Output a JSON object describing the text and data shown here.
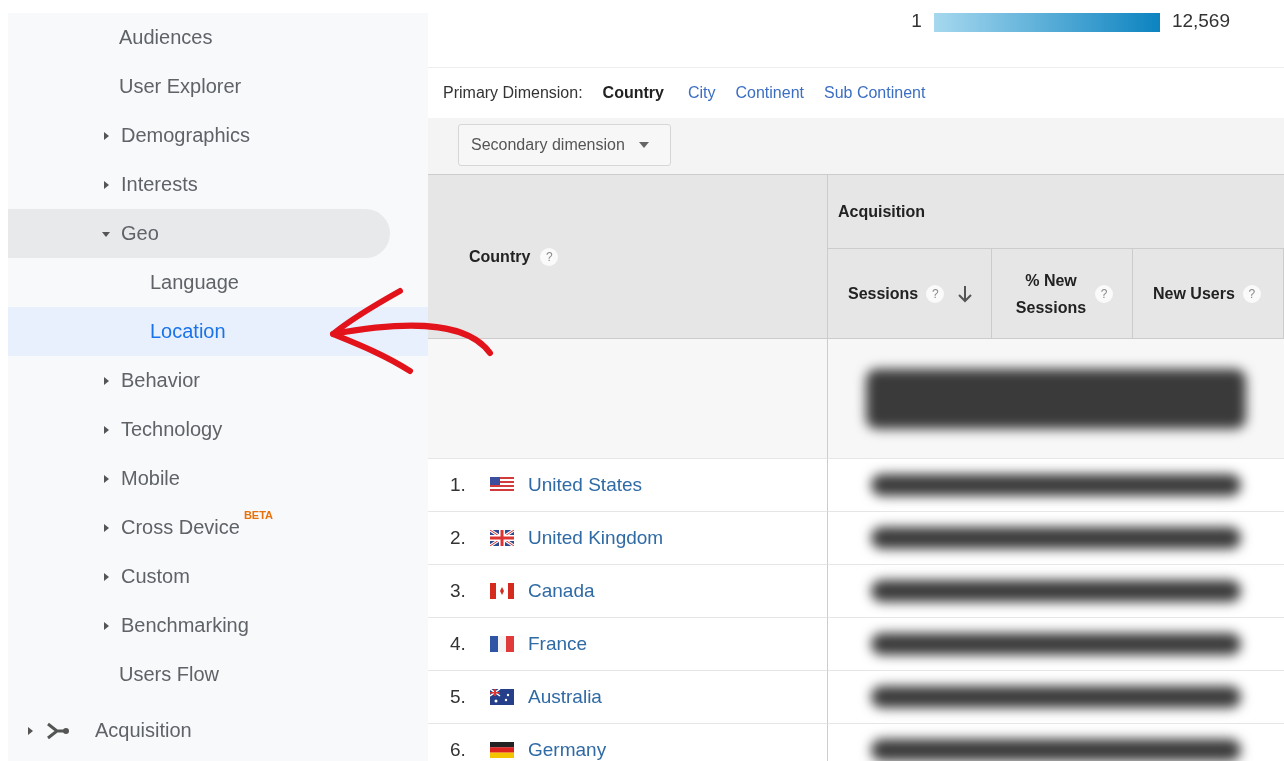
{
  "sidebar": {
    "items": [
      {
        "label": "Audiences",
        "kind": "link",
        "selected": false
      },
      {
        "label": "User Explorer",
        "kind": "link",
        "selected": false
      },
      {
        "label": "Demographics",
        "kind": "group",
        "expanded": false,
        "selected": false
      },
      {
        "label": "Interests",
        "kind": "group",
        "expanded": false,
        "selected": false
      },
      {
        "label": "Geo",
        "kind": "group",
        "expanded": true,
        "selected": false,
        "children": [
          {
            "label": "Language",
            "kind": "link",
            "selected": false
          },
          {
            "label": "Location",
            "kind": "link",
            "selected": true
          }
        ]
      },
      {
        "label": "Behavior",
        "kind": "group",
        "expanded": false,
        "selected": false
      },
      {
        "label": "Technology",
        "kind": "group",
        "expanded": false,
        "selected": false
      },
      {
        "label": "Mobile",
        "kind": "group",
        "expanded": false,
        "selected": false
      },
      {
        "label": "Cross Device",
        "kind": "group",
        "expanded": false,
        "selected": false,
        "badge": "BETA"
      },
      {
        "label": "Custom",
        "kind": "group",
        "expanded": false,
        "selected": false
      },
      {
        "label": "Benchmarking",
        "kind": "group",
        "expanded": false,
        "selected": false
      },
      {
        "label": "Users Flow",
        "kind": "link",
        "selected": false
      }
    ],
    "section": {
      "label": "Acquisition",
      "expanded": false
    }
  },
  "legend": {
    "min": "1",
    "max": "12,569"
  },
  "primary_dimension": {
    "label": "Primary Dimension:",
    "options": [
      {
        "label": "Country",
        "selected": true
      },
      {
        "label": "City",
        "selected": false
      },
      {
        "label": "Continent",
        "selected": false
      },
      {
        "label": "Sub Continent",
        "selected": false
      }
    ]
  },
  "secondary_dimension": {
    "label": "Secondary dimension"
  },
  "table": {
    "dimension_column": "Country",
    "dimension_help": "?",
    "group": "Acquisition",
    "columns": [
      {
        "label": "Sessions",
        "help": "?",
        "sorted": true
      },
      {
        "label": "% New Sessions",
        "help": "?",
        "sorted": false
      },
      {
        "label": "New Users",
        "help": "?",
        "sorted": false
      }
    ],
    "rows": [
      {
        "rank": "1.",
        "country": "United States",
        "kind": "us"
      },
      {
        "rank": "2.",
        "country": "United Kingdom",
        "kind": "gb"
      },
      {
        "rank": "3.",
        "country": "Canada",
        "kind": "ca"
      },
      {
        "rank": "4.",
        "country": "France",
        "kind": "fr"
      },
      {
        "rank": "5.",
        "country": "Australia",
        "kind": "au"
      },
      {
        "rank": "6.",
        "country": "Germany",
        "kind": "de"
      }
    ]
  }
}
